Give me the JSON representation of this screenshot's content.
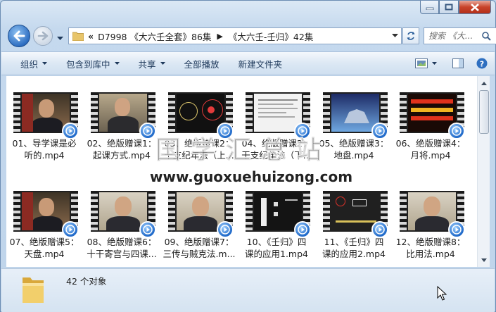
{
  "window": {
    "icons": {
      "minimize": "minimize-icon",
      "maximize": "maximize-icon",
      "close": "close-icon"
    }
  },
  "nav": {
    "back_icon": "back-arrow-icon",
    "forward_icon": "forward-arrow-icon",
    "breadcrumb": [
      "D7998 《大六壬全套》86集",
      "《大六壬-壬归》42集"
    ],
    "search_placeholder": "搜索 《大..."
  },
  "toolbar": {
    "organize": "组织",
    "include_library": "包含到库中",
    "share": "共享",
    "play_all": "全部播放",
    "new_folder": "新建文件夹"
  },
  "files": [
    {
      "line1": "01、导学课是必",
      "line2": "听的.mp4",
      "thumb": "person"
    },
    {
      "line1": "02、绝版赠课1：",
      "line2": "起课方式.mp4",
      "thumb": "person2"
    },
    {
      "line1": "03、绝版赠课2：",
      "line2": "十支纪年法（上...",
      "thumb": "diagram"
    },
    {
      "line1": "04、绝版赠课2：",
      "line2": "干支纪年法（下...",
      "thumb": "doc"
    },
    {
      "line1": "05、绝版赠课3：",
      "line2": "地盘.mp4",
      "thumb": "movie"
    },
    {
      "line1": "06、绝版赠课4：",
      "line2": "月将.mp4",
      "thumb": "redtext"
    },
    {
      "line1": "07、绝版赠课5：",
      "line2": "天盘.mp4",
      "thumb": "person"
    },
    {
      "line1": "08、绝版赠课6：",
      "line2": "十干寄宫与四课...",
      "thumb": "person3"
    },
    {
      "line1": "09、绝版赠课7：",
      "line2": "三传与贼克法.m...",
      "thumb": "person3"
    },
    {
      "line1": "10、《壬归》四",
      "line2": "课的应用1.mp4",
      "thumb": "board"
    },
    {
      "line1": "11、《壬归》四",
      "line2": "课的应用2.mp4",
      "thumb": "board2"
    },
    {
      "line1": "12、绝版赠课8：",
      "line2": "比用法.mp4",
      "thumb": "person3"
    }
  ],
  "watermark": {
    "title": "国学汇总站",
    "url": "www.guoxuehuizong.com"
  },
  "status": {
    "count": "42 个对象"
  }
}
